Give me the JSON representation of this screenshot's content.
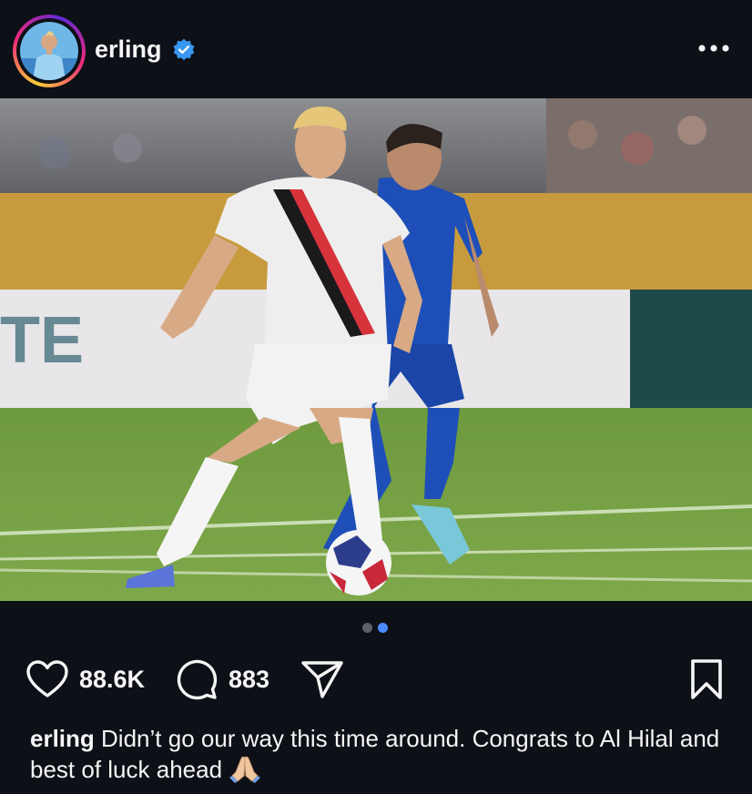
{
  "header": {
    "username": "erling",
    "verified": true,
    "more_icon": "more-horizontal-icon"
  },
  "colors": {
    "background": "#0d1017",
    "text": "#f5f5f5",
    "verified_badge": "#3897f0",
    "active_dot": "#4a8cff",
    "inactive_dot": "#5b5f66"
  },
  "carousel": {
    "current": 2,
    "total": 2
  },
  "actions": {
    "like_icon": "heart-icon",
    "likes": "88.6K",
    "comment_icon": "comment-bubble-icon",
    "comments": "883",
    "share_icon": "paper-plane-icon",
    "save_icon": "bookmark-icon"
  },
  "caption": {
    "username": "erling",
    "text": "Didn’t go our way this time around. Congrats to Al Hilal and best of luck ahead",
    "emoji": "folded-hands-emoji"
  }
}
